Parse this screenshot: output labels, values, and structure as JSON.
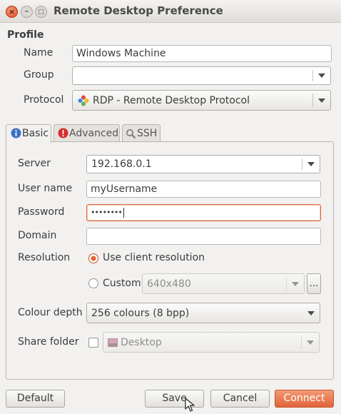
{
  "window": {
    "title": "Remote Desktop Preference",
    "controls": [
      "close-icon",
      "minimize-icon",
      "maximize-icon"
    ]
  },
  "profile": {
    "section_title": "Profile",
    "name_label": "Name",
    "name_value": "Windows Machine",
    "group_label": "Group",
    "group_value": "",
    "protocol_label": "Protocol",
    "protocol_value": "RDP - Remote Desktop Protocol",
    "protocol_icon": "rdp-protocol-icon"
  },
  "tabs": [
    {
      "label": "Basic",
      "icon": "info-icon",
      "active": true
    },
    {
      "label": "Advanced",
      "icon": "warning-icon",
      "active": false
    },
    {
      "label": "SSH",
      "icon": "magnifier-icon",
      "active": false
    }
  ],
  "basic": {
    "server_label": "Server",
    "server_value": "192.168.0.1",
    "username_label": "User name",
    "username_value": "myUsername",
    "password_label": "Password",
    "password_value": "••••••••",
    "domain_label": "Domain",
    "domain_value": "",
    "resolution_label": "Resolution",
    "resolution_client_label": "Use client resolution",
    "resolution_custom_label": "Custom",
    "resolution_custom_value": "640x480",
    "resolution_more_label": "...",
    "colour_depth_label": "Colour depth",
    "colour_depth_value": "256 colours (8 bpp)",
    "share_folder_label": "Share folder",
    "share_folder_value": "Desktop"
  },
  "buttons": {
    "default": "Default",
    "save": "Save",
    "cancel": "Cancel",
    "connect": "Connect"
  },
  "colors": {
    "accent": "#e2643a",
    "focus_border": "#e1693c",
    "window_bg": "#f2f1f0"
  }
}
